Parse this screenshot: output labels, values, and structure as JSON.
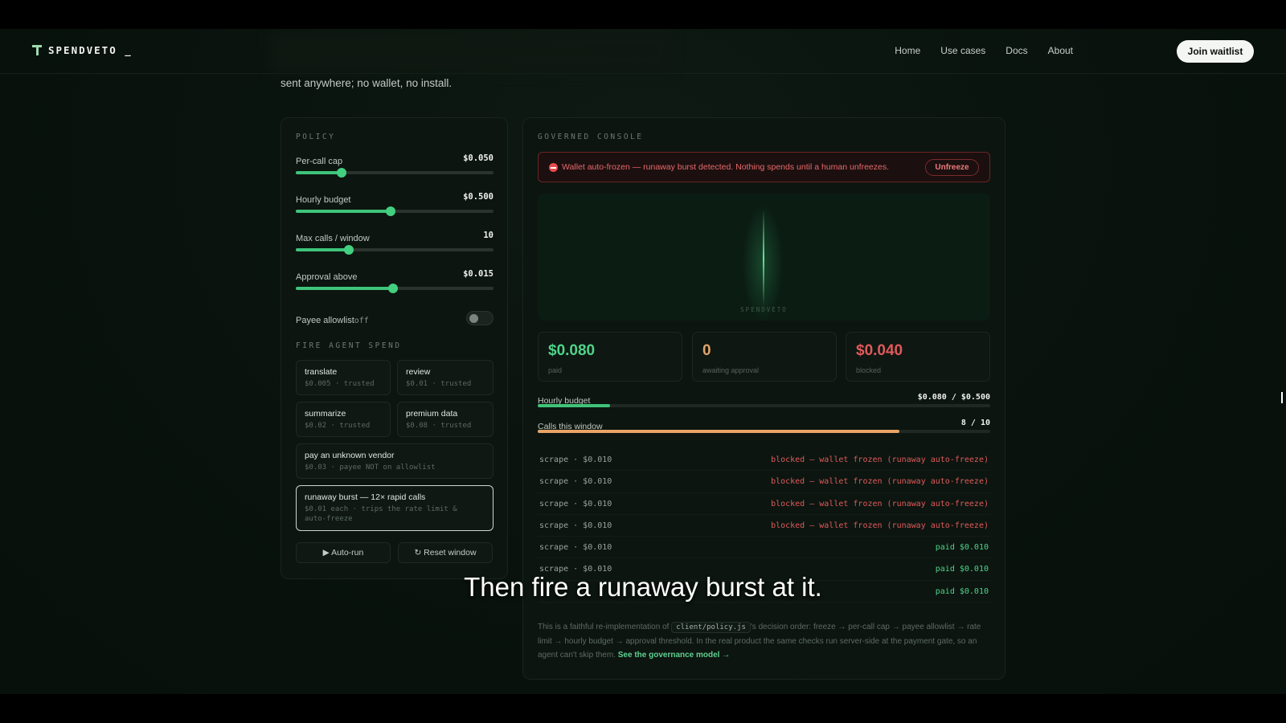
{
  "nav": {
    "brand": "SPENDVETO _",
    "links": [
      "Home",
      "Use cases",
      "Docs",
      "About"
    ],
    "cta": "Join waitlist"
  },
  "intro": "sent anywhere; no wallet, no install.",
  "policy": {
    "title": "POLICY",
    "sliders": [
      {
        "label": "Per-call cap",
        "value": "$0.050",
        "level": 0.23
      },
      {
        "label": "Hourly budget",
        "value": "$0.500",
        "level": 0.48
      },
      {
        "label": "Max calls / window",
        "value": "10",
        "level": 0.27
      },
      {
        "label": "Approval above",
        "value": "$0.015",
        "level": 0.49
      }
    ],
    "allowlist": {
      "label": "Payee allowlist",
      "state": "off",
      "enabled": false
    },
    "fire_title": "FIRE AGENT SPEND",
    "actions": [
      {
        "title": "translate",
        "sub": "$0.005 · trusted"
      },
      {
        "title": "review",
        "sub": "$0.01 · trusted"
      },
      {
        "title": "summarize",
        "sub": "$0.02 · trusted"
      },
      {
        "title": "premium data",
        "sub": "$0.08 · trusted"
      },
      {
        "title": "pay an unknown vendor",
        "sub": "$0.03 · payee NOT on allowlist"
      },
      {
        "title": "runaway burst — 12× rapid calls",
        "sub": "$0.01 each · trips the rate limit & auto-freeze"
      }
    ],
    "autorun": "▶ Auto-run",
    "reset": "↻ Reset window"
  },
  "console": {
    "title": "GOVERNED CONSOLE",
    "alert": "Wallet auto-frozen — runaway burst detected. Nothing spends until a human unfreezes.",
    "unfreeze": "Unfreeze",
    "watermark": "SPENDVETO",
    "stats": [
      {
        "value": "$0.080",
        "label": "paid",
        "color": "#4fd48a"
      },
      {
        "value": "0",
        "label": "awaiting approval",
        "color": "#e0a46a"
      },
      {
        "value": "$0.040",
        "label": "blocked",
        "color": "#e05a5a"
      }
    ],
    "hourly": {
      "label": "Hourly budget",
      "value": "$0.080 / $0.500",
      "level": 0.16,
      "color": "#3ec47a"
    },
    "calls": {
      "label": "Calls this window",
      "value": "8 / 10",
      "level": 0.8,
      "color": "#e8a466"
    },
    "log": [
      {
        "left": "scrape · $0.010",
        "right": "blocked — wallet frozen (runaway auto-freeze)",
        "status": "blocked"
      },
      {
        "left": "scrape · $0.010",
        "right": "blocked — wallet frozen (runaway auto-freeze)",
        "status": "blocked"
      },
      {
        "left": "scrape · $0.010",
        "right": "blocked — wallet frozen (runaway auto-freeze)",
        "status": "blocked"
      },
      {
        "left": "scrape · $0.010",
        "right": "blocked — wallet frozen (runaway auto-freeze)",
        "status": "blocked"
      },
      {
        "left": "scrape · $0.010",
        "right": "paid $0.010",
        "status": "paid"
      },
      {
        "left": "scrape · $0.010",
        "right": "paid $0.010",
        "status": "paid"
      },
      {
        "left": "",
        "right": "paid $0.010",
        "status": "paid"
      }
    ],
    "footnote_pre": "This is a faithful re-implementation of ",
    "footnote_code": "client/policy.js",
    "footnote_post": "'s decision order: freeze → per-call cap → payee allowlist → rate limit → hourly budget → approval threshold. In the real product the same checks run server-side at the payment gate, so an agent can't skip them. ",
    "footnote_link": "See the governance model →"
  },
  "caption": "Then fire a runaway burst at it.",
  "colors": {
    "accent": "#3ec47a",
    "blocked": "#e05a5a",
    "paid": "#4fd48a"
  }
}
